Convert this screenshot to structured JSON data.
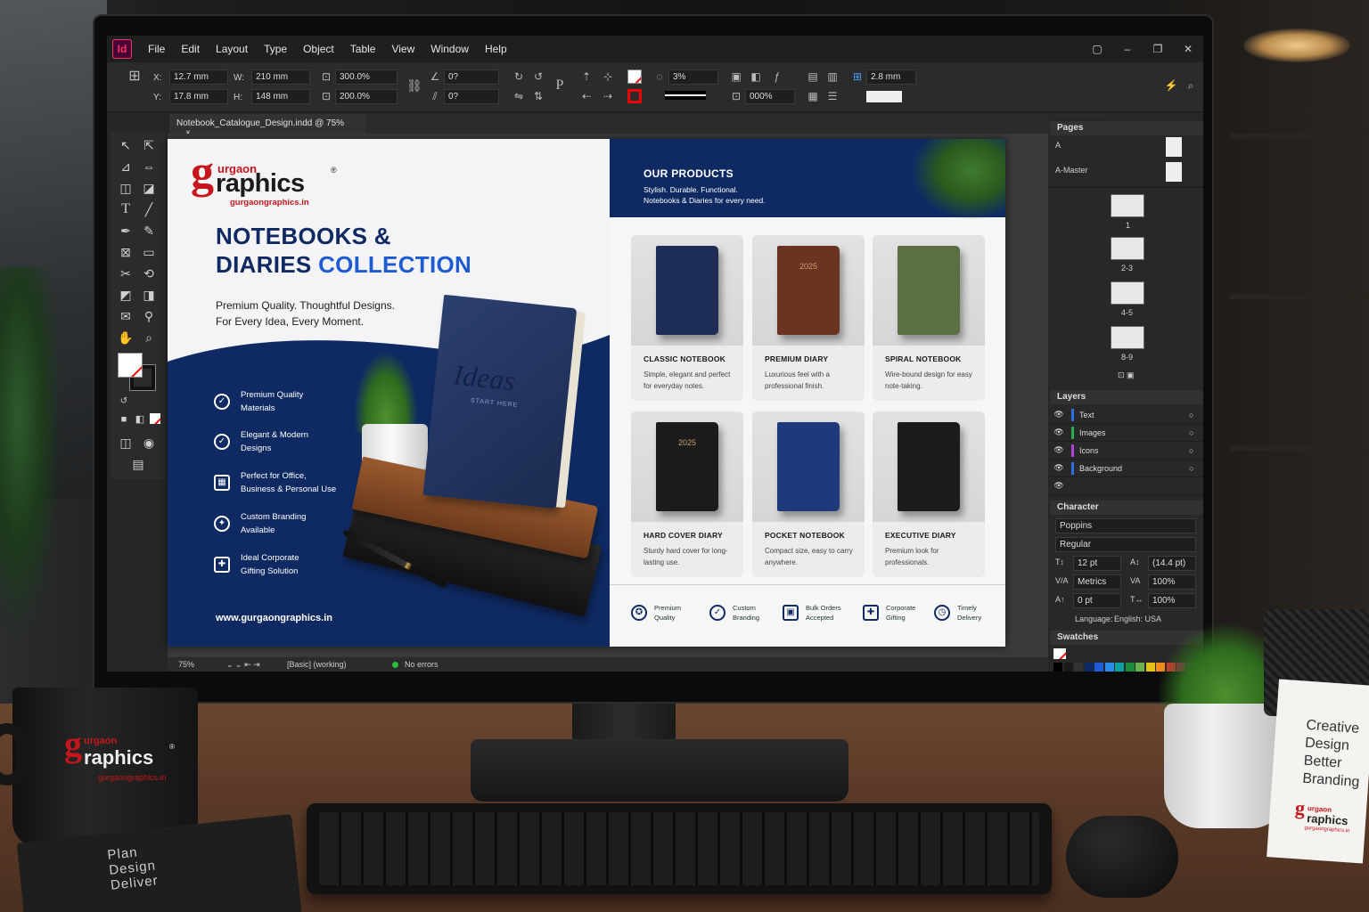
{
  "app": {
    "logo_text": "Id",
    "menu": [
      "File",
      "Edit",
      "Layout",
      "Type",
      "Object",
      "Table",
      "View",
      "Window",
      "Help"
    ]
  },
  "control_panel": {
    "x_label": "X:",
    "x_value": "12.7 mm",
    "y_label": "Y:",
    "y_value": "17.8 mm",
    "w_label": "W:",
    "w_value": "210 mm",
    "h_label": "H:",
    "h_value": "148 mm",
    "scale_x": "300.0%",
    "scale_y": "200.0%",
    "angle_1": "0?",
    "angle_2": "0?",
    "opacity": "3%",
    "stroke_weight": "000%",
    "gap_value": "2.8 mm"
  },
  "document_tab": {
    "label": "Notebook_Catalogue_Design.indd @ 75%",
    "close": "×"
  },
  "status_bar": {
    "zoom": "75%",
    "profile": "[Basic] (working)",
    "errors": "No errors"
  },
  "left_page": {
    "logo_g": "g",
    "logo_top": "urgaon",
    "logo_main": "raphics",
    "logo_reg": "®",
    "logo_url": "gurgaongraphics.in",
    "title_line1": "NOTEBOOKS &",
    "title_line2_a": "DIARIES",
    "title_line2_b": "COLLECTION",
    "tagline_1": "Premium Quality. Thoughtful Designs.",
    "tagline_2": "For Every Idea, Every Moment.",
    "book_cover_text": "Ideas",
    "book_cover_sub": "START HERE",
    "features": [
      {
        "icon": "shield-check-icon",
        "line1": "Premium Quality",
        "line2": "Materials"
      },
      {
        "icon": "check-circle-icon",
        "line1": "Elegant & Modern",
        "line2": "Designs"
      },
      {
        "icon": "office-icon",
        "line1": "Perfect for Office,",
        "line2": "Business & Personal Use"
      },
      {
        "icon": "branding-icon",
        "line1": "Custom Branding",
        "line2": "Available"
      },
      {
        "icon": "gift-icon",
        "line1": "Ideal Corporate",
        "line2": "Gifting Solution"
      }
    ],
    "website": "www.gurgaongraphics.in"
  },
  "right_page": {
    "heading": "OUR PRODUCTS",
    "sub_1": "Stylish. Durable. Functional.",
    "sub_2": "Notebooks & Diaries for every need.",
    "products": [
      {
        "title": "CLASSIC NOTEBOOK",
        "desc": "Simple, elegant and perfect for everyday notes.",
        "color": "#1d2d55",
        "label": ""
      },
      {
        "title": "PREMIUM DIARY",
        "desc": "Luxurious feel with a professional finish.",
        "color": "#6b3321",
        "label": "2025"
      },
      {
        "title": "SPIRAL NOTEBOOK",
        "desc": "Wire-bound design for easy note-taking.",
        "color": "#5a7042",
        "label": ""
      },
      {
        "title": "HARD COVER DIARY",
        "desc": "Sturdy hard cover for long-lasting use.",
        "color": "#1b1b1b",
        "label": "2025"
      },
      {
        "title": "POCKET NOTEBOOK",
        "desc": "Compact size, easy to carry anywhere.",
        "color": "#1e3a7a",
        "label": ""
      },
      {
        "title": "EXECUTIVE DIARY",
        "desc": "Premium look for professionals.",
        "color": "#1c1c1c",
        "label": ""
      }
    ],
    "benefits": [
      {
        "icon": "badge-icon",
        "line1": "Premium",
        "line2": "Quality"
      },
      {
        "icon": "pen-check-icon",
        "line1": "Custom",
        "line2": "Branding"
      },
      {
        "icon": "box-icon",
        "line1": "Bulk Orders",
        "line2": "Accepted"
      },
      {
        "icon": "gift-icon",
        "line1": "Corporate",
        "line2": "Gifting"
      },
      {
        "icon": "clock-icon",
        "line1": "Timely",
        "line2": "Delivery"
      }
    ]
  },
  "panels": {
    "pages": {
      "title": "Pages",
      "none_label": "A",
      "master_label": "A-Master",
      "page_labels": [
        "1",
        "2-3",
        "4-5",
        "8-9"
      ]
    },
    "layers": {
      "title": "Layers",
      "items": [
        {
          "name": "Text",
          "color": "#2f6fe0"
        },
        {
          "name": "Images",
          "color": "#22b14c"
        },
        {
          "name": "Icons",
          "color": "#b042d8"
        },
        {
          "name": "Background",
          "color": "#2f6fe0"
        }
      ]
    },
    "character": {
      "title": "Character",
      "font_family": "Poppins",
      "font_style": "Regular",
      "size": "12 pt",
      "leading": "(14.4 pt)",
      "kerning": "Metrics",
      "tracking": "100%",
      "baseline": "0 pt",
      "h_scale": "100%",
      "language_label": "Language:",
      "language": "English: USA"
    },
    "swatches": {
      "title": "Swatches",
      "colors": [
        "#000000",
        "#1a1a1a",
        "#333333",
        "#0b2a66",
        "#1e5bd6",
        "#2a8be8",
        "#0aa0a0",
        "#1b8a3b",
        "#6ab04c",
        "#e2c21a",
        "#f08a1a",
        "#e03131",
        "#c2185b",
        "#7b1fa2",
        "#ffffff",
        "#cccccc",
        "#888888",
        "#f4b400",
        "#8d6e63",
        "#5d4037",
        "#9e9e9e",
        "#263238",
        "#b71c1c",
        "#0d47a1"
      ]
    }
  },
  "desk": {
    "mug_logo_g": "g",
    "mug_logo_top": "urgaon",
    "mug_logo_main": "raphics",
    "mug_logo_reg": "®",
    "mug_url": "gurgaongraphics.in",
    "notebook_lines": [
      "Plan",
      "Design",
      "Deliver"
    ],
    "card_lines": [
      "Creative",
      "Design",
      "Better",
      "Branding"
    ],
    "card_logo_g": "g",
    "card_logo_top": "urgaon",
    "card_logo_main": "raphics",
    "card_url": "gurgaongraphics.in"
  }
}
